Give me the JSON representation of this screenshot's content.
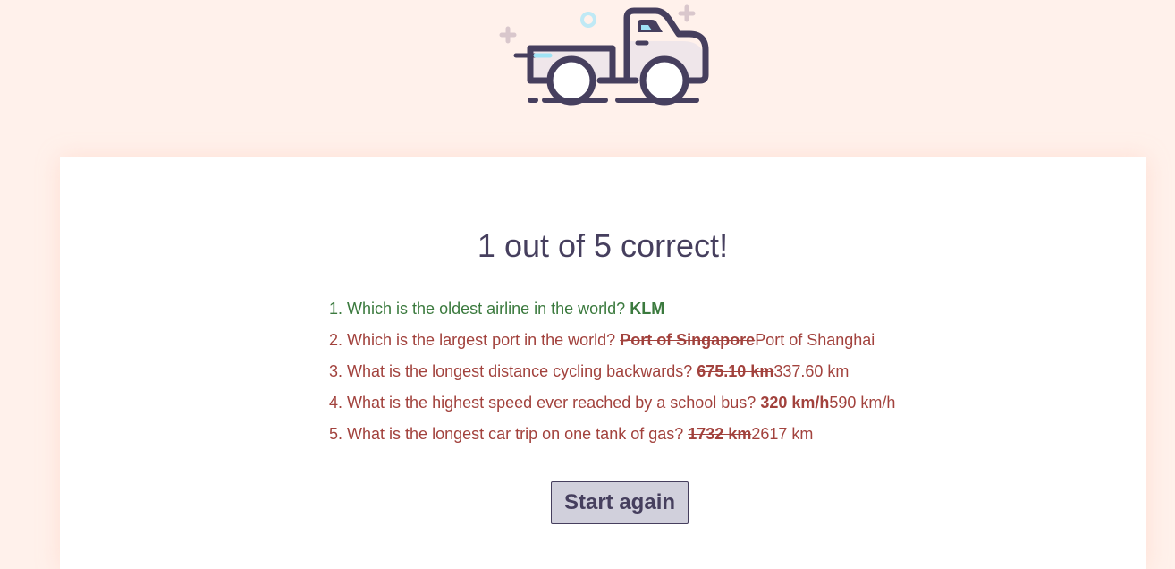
{
  "header": {
    "logo_icon": "pickup-truck-icon"
  },
  "result": {
    "title": "1 out of 5 correct!"
  },
  "questions": [
    {
      "number": "1.",
      "question": "Which is the oldest airline in the world?",
      "given": "",
      "answer": "KLM",
      "status": "correct"
    },
    {
      "number": "2.",
      "question": "Which is the largest port in the world?",
      "given": "Port of Singapore",
      "answer": "Port of Shanghai",
      "status": "wrong"
    },
    {
      "number": "3.",
      "question": "What is the longest distance cycling backwards?",
      "given": "675.10 km",
      "answer": "337.60 km",
      "status": "wrong"
    },
    {
      "number": "4.",
      "question": "What is the highest speed ever reached by a school bus?",
      "given": "320 km/h",
      "answer": "590 km/h",
      "status": "wrong"
    },
    {
      "number": "5.",
      "question": "What is the longest car trip on one tank of gas?",
      "given": "1732 km",
      "answer": "2617 km",
      "status": "wrong"
    }
  ],
  "actions": {
    "restart_label": "Start again"
  },
  "colors": {
    "background": "#fff1eb",
    "card": "#ffffff",
    "primary": "#463f5e",
    "correct": "#3b7a3e",
    "wrong": "#a2423d",
    "button_bg": "#d1d0dc"
  }
}
